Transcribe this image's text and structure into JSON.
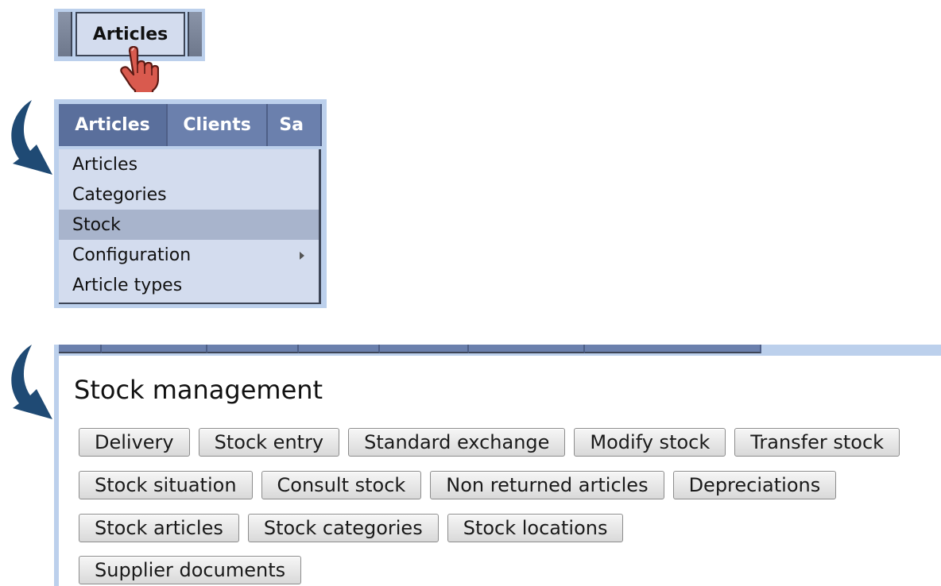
{
  "panel1": {
    "button_label": "Articles"
  },
  "menubar": {
    "tabs": [
      "Articles",
      "Clients",
      "Sa"
    ]
  },
  "dropdown": {
    "items": [
      "Articles",
      "Categories",
      "Stock",
      "Configuration",
      "Article types"
    ],
    "highlighted": "Stock"
  },
  "stock": {
    "title": "Stock management",
    "rows": [
      [
        "Delivery",
        "Stock entry",
        "Standard exchange",
        "Modify stock",
        "Transfer stock"
      ],
      [
        "Stock situation",
        "Consult stock",
        "Non returned articles",
        "Depreciations"
      ],
      [
        "Stock articles",
        "Stock categories",
        "Stock locations"
      ],
      [
        "Supplier documents"
      ]
    ]
  },
  "colors": {
    "panel_background": "#bcd0ec",
    "menu_tab": "#6b80ad",
    "dropdown_background": "#d3dcee",
    "dropdown_highlight": "#a8b4cc",
    "arrow": "#1f4a74"
  },
  "icons": [
    "hand-cursor-icon",
    "curved-arrow-icon",
    "submenu-arrow-icon"
  ]
}
